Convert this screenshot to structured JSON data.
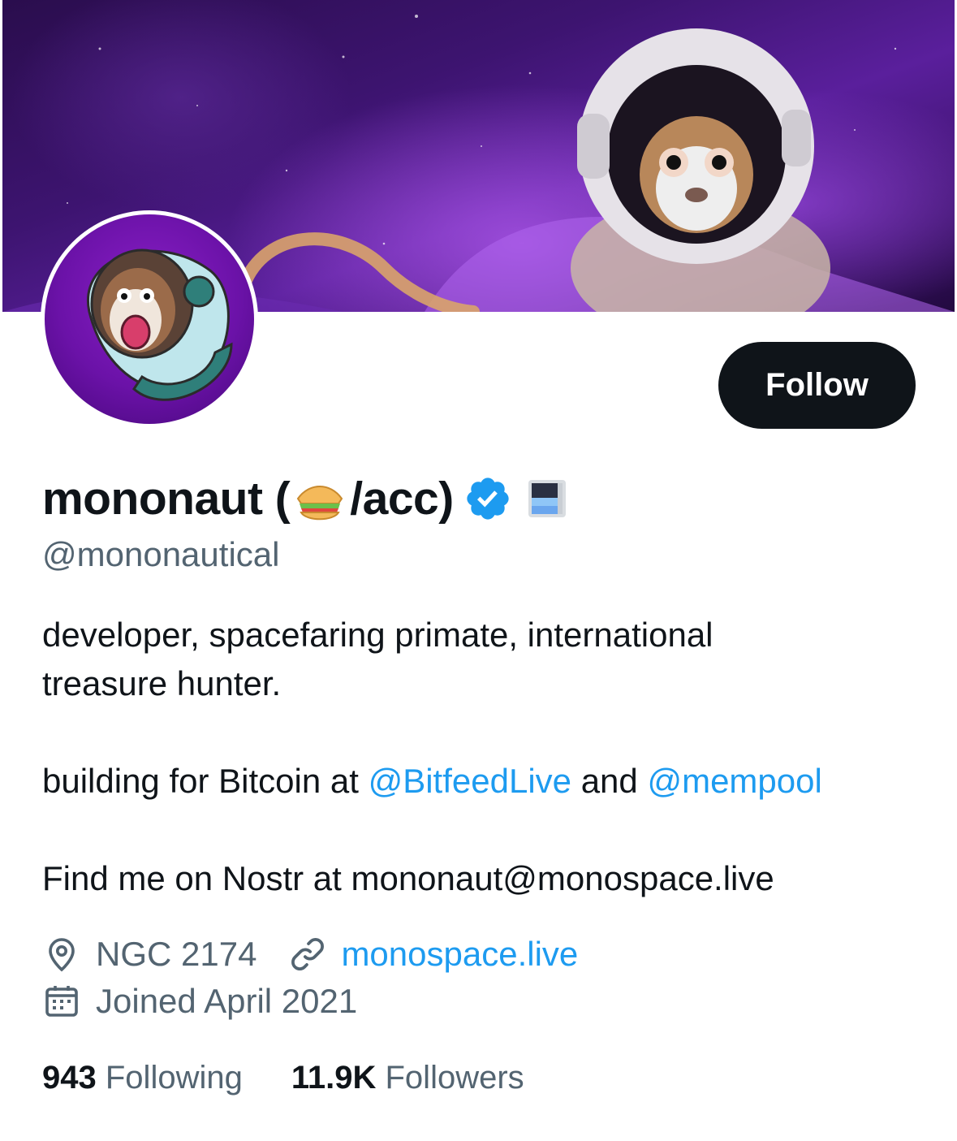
{
  "profile": {
    "display_name_prefix": "mononaut (",
    "display_name_emoji": "sandwich-emoji",
    "display_name_suffix": "/acc)",
    "handle": "@mononautical",
    "follow_label": "Follow",
    "bio": {
      "line1": "developer, spacefaring primate, international treasure hunter.",
      "line2_prefix": "building for Bitcoin at ",
      "mention1": "@BitfeedLive",
      "line2_middle": " and ",
      "mention2": "@mempool",
      "line3": "Find me on Nostr at mononaut@monospace.live"
    },
    "location": "NGC 2174",
    "website": "monospace.live",
    "joined": "Joined April 2021",
    "following_count": "943",
    "following_label": "Following",
    "followers_count": "11.9K",
    "followers_label": "Followers"
  },
  "icons": {
    "verified": "verified-badge-icon",
    "affiliate": "affiliate-flag-icon",
    "location": "location-pin-icon",
    "link": "link-icon",
    "calendar": "calendar-icon"
  },
  "colors": {
    "accent": "#1d9bf0",
    "secondary_text": "#536471",
    "primary_text": "#0f1419",
    "follow_button_bg": "#0f1419"
  }
}
